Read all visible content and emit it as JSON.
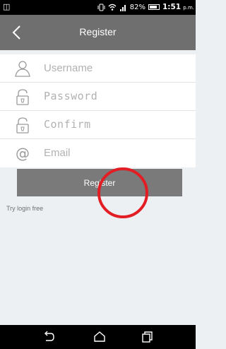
{
  "status_bar": {
    "battery": "82%",
    "battery_level": 0.82,
    "time": "1:51",
    "ampm": "p.m."
  },
  "header": {
    "title": "Register",
    "back_icon": "chevron-left-icon"
  },
  "form": {
    "username_placeholder": "Username",
    "password_placeholder": "Password",
    "confirm_placeholder": "Confirm",
    "email_placeholder": "Email",
    "username_icon": "user-icon",
    "password_icon": "lock-icon",
    "confirm_icon": "lock-icon",
    "email_icon": "at-icon"
  },
  "register_button": {
    "label": "Register"
  },
  "try_login_label": "Try login free",
  "annotation": {
    "color": "#e21d23"
  },
  "colors": {
    "header_bg": "#6f6f6f",
    "button_bg": "#7a7a7a",
    "page_bg": "#ecf0f3"
  }
}
